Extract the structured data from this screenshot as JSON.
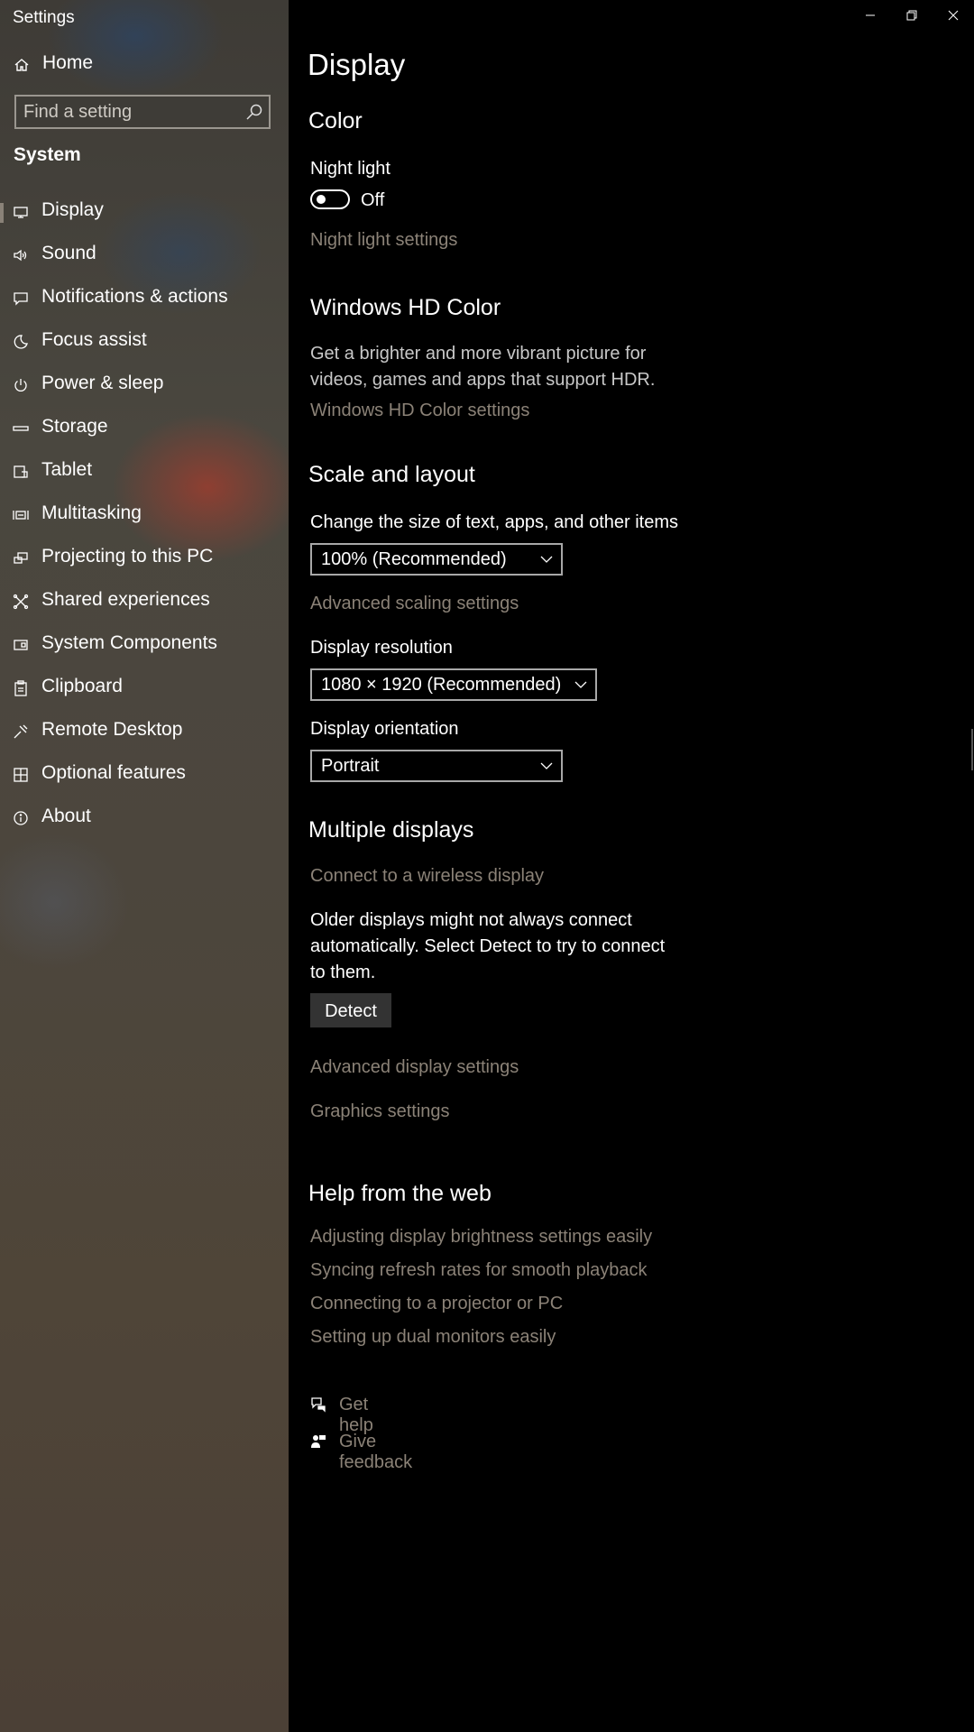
{
  "window": {
    "title": "Settings"
  },
  "sidebar": {
    "home_label": "Home",
    "search_placeholder": "Find a setting",
    "section": "System",
    "items": [
      {
        "label": "Display",
        "icon": "monitor-icon"
      },
      {
        "label": "Sound",
        "icon": "speaker-icon"
      },
      {
        "label": "Notifications & actions",
        "icon": "notification-icon"
      },
      {
        "label": "Focus assist",
        "icon": "moon-icon"
      },
      {
        "label": "Power & sleep",
        "icon": "power-icon"
      },
      {
        "label": "Storage",
        "icon": "storage-icon"
      },
      {
        "label": "Tablet",
        "icon": "tablet-icon"
      },
      {
        "label": "Multitasking",
        "icon": "multitasking-icon"
      },
      {
        "label": "Projecting to this PC",
        "icon": "projecting-icon"
      },
      {
        "label": "Shared experiences",
        "icon": "shared-experiences-icon"
      },
      {
        "label": "System Components",
        "icon": "components-icon"
      },
      {
        "label": "Clipboard",
        "icon": "clipboard-icon"
      },
      {
        "label": "Remote Desktop",
        "icon": "remote-desktop-icon"
      },
      {
        "label": "Optional features",
        "icon": "optional-features-icon"
      },
      {
        "label": "About",
        "icon": "info-icon"
      }
    ],
    "active_index": 0
  },
  "main": {
    "title": "Display",
    "color": {
      "heading": "Color",
      "night_light_label": "Night light",
      "night_light_state": "Off",
      "night_light_link": "Night light settings"
    },
    "hdr": {
      "heading": "Windows HD Color",
      "desc_line1": "Get a brighter and more vibrant picture for",
      "desc_line2": "videos, games and apps that support HDR.",
      "link": "Windows HD Color settings"
    },
    "scale": {
      "heading": "Scale and layout",
      "size_label": "Change the size of text, apps, and other items",
      "size_value": "100% (Recommended)",
      "advanced_link": "Advanced scaling settings",
      "resolution_label": "Display resolution",
      "resolution_value": "1080 × 1920 (Recommended)",
      "orientation_label": "Display orientation",
      "orientation_value": "Portrait"
    },
    "multi": {
      "heading": "Multiple displays",
      "wireless_link": "Connect to a wireless display",
      "desc_line1": "Older displays might not always connect",
      "desc_line2": "automatically. Select Detect to try to connect",
      "desc_line3": "to them.",
      "detect_button": "Detect",
      "advanced_display_link": "Advanced display settings",
      "graphics_link": "Graphics settings"
    },
    "help": {
      "heading": "Help from the web",
      "links": [
        "Adjusting display brightness settings easily",
        "Syncing refresh rates for smooth playback",
        "Connecting to a projector or PC",
        "Setting up dual monitors easily"
      ],
      "get_help": "Get help",
      "give_feedback": "Give feedback"
    }
  }
}
